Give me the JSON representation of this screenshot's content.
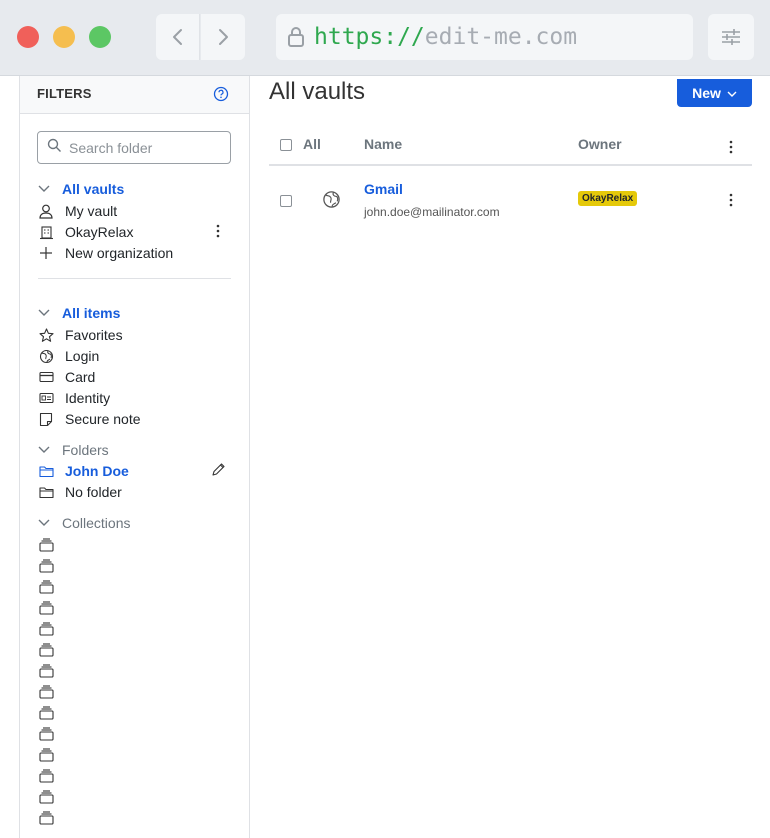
{
  "browser": {
    "url_scheme": "https://",
    "url_host": "edit-me.com"
  },
  "sidebar": {
    "title": "FILTERS",
    "search_placeholder": "Search folder",
    "vaults": {
      "header": "All vaults",
      "items": [
        {
          "label": "My vault",
          "icon": "user-icon"
        },
        {
          "label": "OkayRelax",
          "icon": "institution-icon"
        },
        {
          "label": "New organization",
          "icon": "plus-icon"
        }
      ]
    },
    "types": {
      "header": "All items",
      "items": [
        {
          "label": "Favorites",
          "icon": "star-icon"
        },
        {
          "label": "Login",
          "icon": "globe-icon"
        },
        {
          "label": "Card",
          "icon": "credit-card-icon"
        },
        {
          "label": "Identity",
          "icon": "id-card-icon"
        },
        {
          "label": "Secure note",
          "icon": "sticky-note-icon"
        }
      ]
    },
    "folders": {
      "header": "Folders",
      "items": [
        {
          "label": "John Doe",
          "icon": "folder-icon",
          "active": true
        },
        {
          "label": "No folder",
          "icon": "folder-icon"
        }
      ]
    },
    "collections": {
      "header": "Collections",
      "item_count_visible": 14
    }
  },
  "main": {
    "title": "All vaults",
    "new_button": "New",
    "table": {
      "col_all": "All",
      "col_name": "Name",
      "col_owner": "Owner"
    },
    "items": [
      {
        "name": "Gmail",
        "username": "john.doe@mailinator.com",
        "owner": "OkayRelax",
        "icon": "globe-icon"
      }
    ]
  },
  "colors": {
    "accent": "#175ddc",
    "badge": "#e5c90a",
    "url_green": "#2fa84f"
  }
}
